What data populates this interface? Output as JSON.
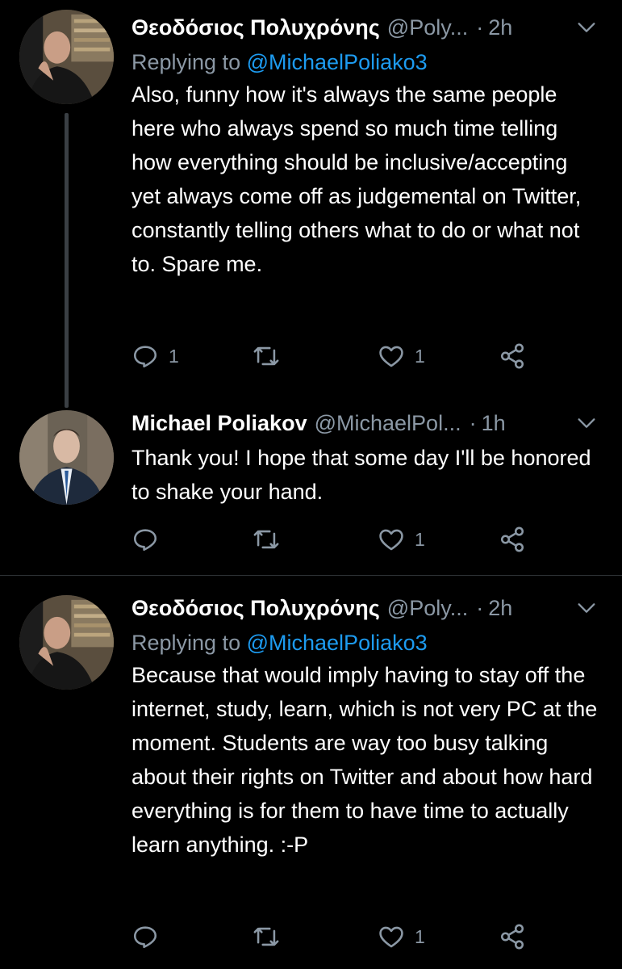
{
  "colors": {
    "background": "#000000",
    "text": "#ffffff",
    "secondary": "#8b98a5",
    "link": "#1d9bf0",
    "divider": "#2f3336"
  },
  "tweets": [
    {
      "author_name": "Θεοδόσιος Πολυχρόνης",
      "handle": "@Poly...",
      "dot": "·",
      "time": "2h",
      "reply_prefix": "Replying to",
      "reply_mention": "@MichaelPoliako3",
      "text": "Also, funny how it's always the same people here who always spend so much time telling how everything should be inclusive/accepting yet always come off as judgemental on Twitter, constantly telling others what to do or what not to. Spare me.",
      "reply_count": "1",
      "retweet_count": "",
      "like_count": "1"
    },
    {
      "author_name": "Michael Poliakov",
      "handle": "@MichaelPol...",
      "dot": "·",
      "time": "1h",
      "text": "Thank you! I hope that some day I'll be honored to shake your hand.",
      "reply_count": "",
      "retweet_count": "",
      "like_count": "1"
    },
    {
      "author_name": "Θεοδόσιος Πολυχρόνης",
      "handle": "@Poly...",
      "dot": "·",
      "time": "2h",
      "reply_prefix": "Replying to",
      "reply_mention": "@MichaelPoliako3",
      "text": "Because that would imply having to stay off the internet, study, learn, which is not very PC at the moment. Students are way too busy talking about their rights on Twitter and about how hard everything is for them to have time to actually learn anything. :-P",
      "reply_count": "",
      "retweet_count": "",
      "like_count": "1"
    }
  ],
  "icons": {
    "reply": "reply-icon",
    "retweet": "retweet-icon",
    "like": "heart-icon",
    "share": "share-icon",
    "more": "chevron-down-icon"
  }
}
